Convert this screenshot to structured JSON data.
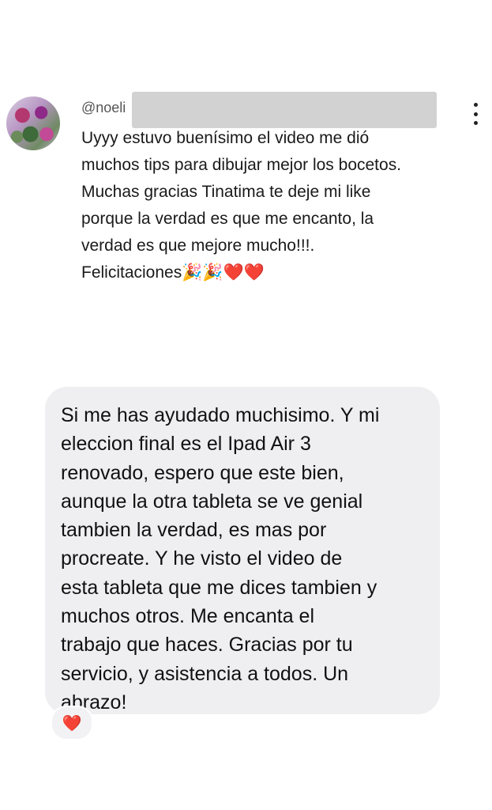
{
  "comment": {
    "handle": "@noeli",
    "text": "Uyyy estuvo buenísimo el video me dió\nmuchos tips para dibujar mejor los bocetos.\nMuchas gracias Tinatima te deje mi like\nporque la verdad es que me encanto, la\nverdad es que mejore mucho!!!.\nFelicitaciones🎉🎉❤️❤️"
  },
  "message": {
    "text": "Si me has ayudado muchisimo. Y mi\neleccion final es el Ipad Air 3\nrenovado, espero que este bien,\naunque la otra tableta se ve genial\ntambien la verdad, es mas por\nprocreate. Y he visto el video de\nesta tableta que me dices tambien y\nmuchos otros. Me encanta el\ntrabajo que haces. Gracias por tu\nservicio, y asistencia a todos. Un\nabrazo!",
    "reaction": "❤️"
  },
  "icons": {
    "more": "more-vertical-icon",
    "redaction_color": "#d2d2d2",
    "bubble_color": "#efeff1"
  }
}
